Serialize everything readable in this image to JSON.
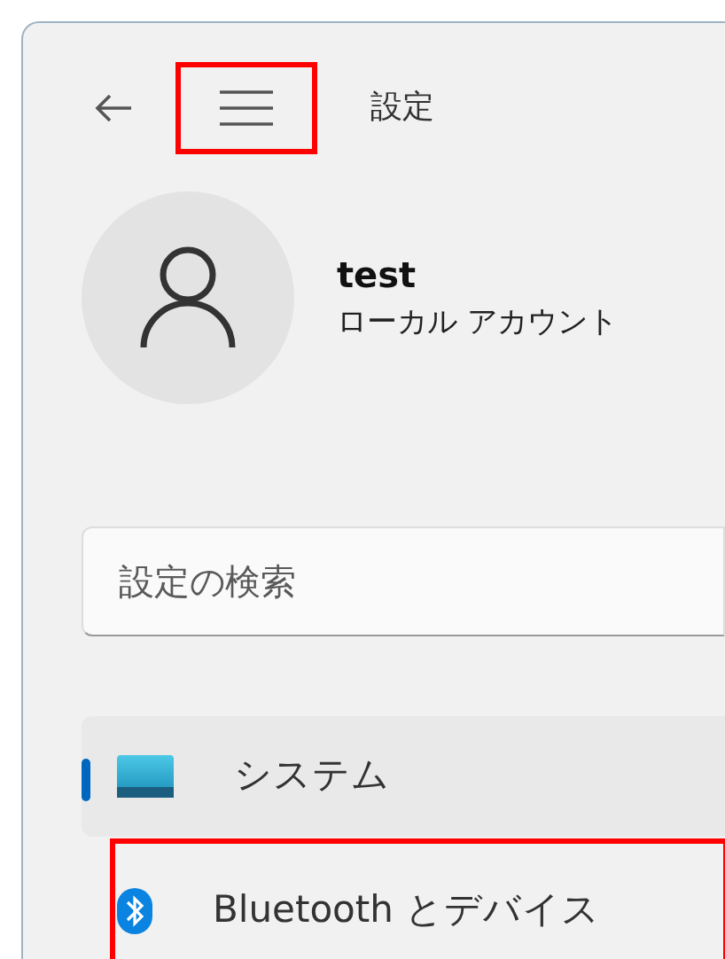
{
  "window": {
    "title": "設定"
  },
  "menu_button": {
    "highlighted": true
  },
  "account": {
    "name": "test",
    "type": "ローカル アカウント"
  },
  "search": {
    "placeholder": "設定の検索"
  },
  "nav_items": [
    {
      "label": "システム",
      "kind": "system",
      "selected": true,
      "highlighted": false
    },
    {
      "label": "Bluetooth とデバイス",
      "kind": "bluetooth",
      "selected": false,
      "highlighted": true
    }
  ]
}
